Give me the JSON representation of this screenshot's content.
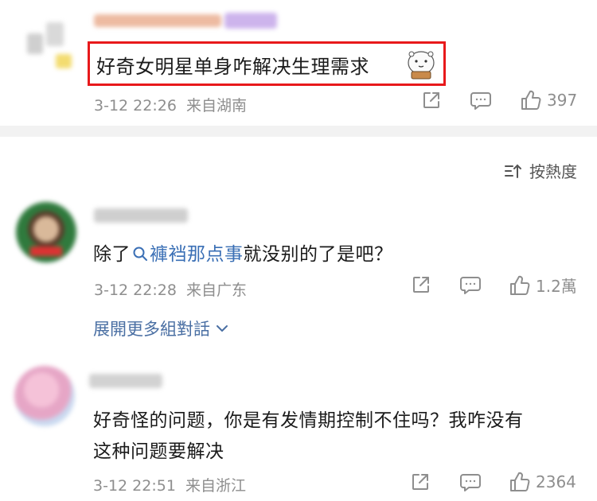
{
  "post": {
    "text": "好奇女明星单身咋解决生理需求",
    "time": "3-12 22:26",
    "location": "来自湖南",
    "like_count": "397"
  },
  "sort": {
    "label": "按熱度"
  },
  "comments": [
    {
      "text_prefix": "除了",
      "topic": "褲裆那点事",
      "text_suffix": "就没别的了是吧？",
      "time": "3-12 22:28",
      "location": "来自广东",
      "like_count": "1.2萬",
      "expand_label": "展開更多組對話"
    },
    {
      "text_line1": "好奇怪的问题，你是有发情期控制不住吗？我咋没有",
      "text_line2": "这种问题要解决",
      "time": "3-12 22:51",
      "location": "来自浙江",
      "like_count": "2364"
    }
  ],
  "icons": {
    "share": "share-icon",
    "comment": "comment-icon",
    "like": "thumbs-up-icon",
    "sort": "sort-icon",
    "search": "search-icon",
    "expand": "chevron-down-icon"
  },
  "colors": {
    "highlight_border": "#e8191b",
    "link": "#3a6fb5",
    "meta_gray": "#8e8e8e",
    "separator": "#f2f2f2"
  }
}
